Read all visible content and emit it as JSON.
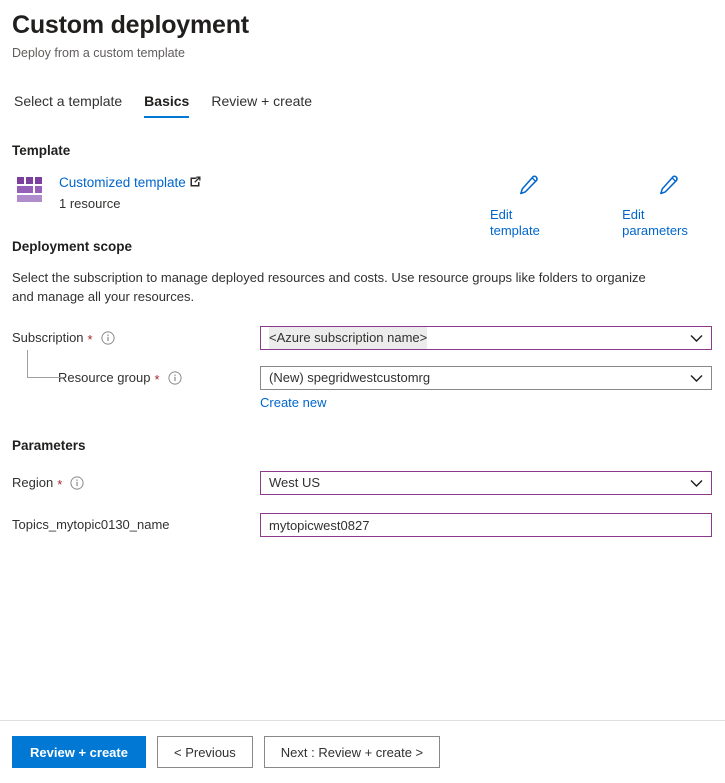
{
  "header": {
    "title": "Custom deployment",
    "subtitle": "Deploy from a custom template"
  },
  "tabs": [
    {
      "label": "Select a template",
      "selected": false
    },
    {
      "label": "Basics",
      "selected": true
    },
    {
      "label": "Review + create",
      "selected": false
    }
  ],
  "template_section": {
    "heading": "Template",
    "icon": "template-grid-icon",
    "link_label": "Customized template",
    "external_link_icon": "external-link-icon",
    "resource_count": "1 resource",
    "actions": [
      {
        "icon": "pencil-icon",
        "label": "Edit template"
      },
      {
        "icon": "pencil-icon",
        "label": "Edit parameters"
      }
    ]
  },
  "deployment_scope": {
    "heading": "Deployment scope",
    "description": "Select the subscription to manage deployed resources and costs. Use resource groups like folders to organize and manage all your resources.",
    "subscription": {
      "label": "Subscription",
      "required": "*",
      "info_icon": "info-icon",
      "value": "<Azure subscription name>",
      "chevron_icon": "chevron-down-icon"
    },
    "resource_group": {
      "label": "Resource group",
      "required": "*",
      "info_icon": "info-icon",
      "value": "(New) spegridwestcustomrg",
      "chevron_icon": "chevron-down-icon",
      "create_new_label": "Create new"
    }
  },
  "parameters": {
    "heading": "Parameters",
    "region": {
      "label": "Region",
      "required": "*",
      "info_icon": "info-icon",
      "value": "West US",
      "chevron_icon": "chevron-down-icon"
    },
    "topic_name": {
      "label": "Topics_mytopic0130_name",
      "value": "mytopicwest0827",
      "placeholder": ""
    }
  },
  "footer": {
    "review_create": "Review + create",
    "previous": "< Previous",
    "next": "Next : Review + create >"
  },
  "colors": {
    "accent_blue": "#0078d4",
    "link_blue": "#0066cc",
    "focus_purple": "#8c3a8c",
    "required_red": "#a4262c"
  }
}
